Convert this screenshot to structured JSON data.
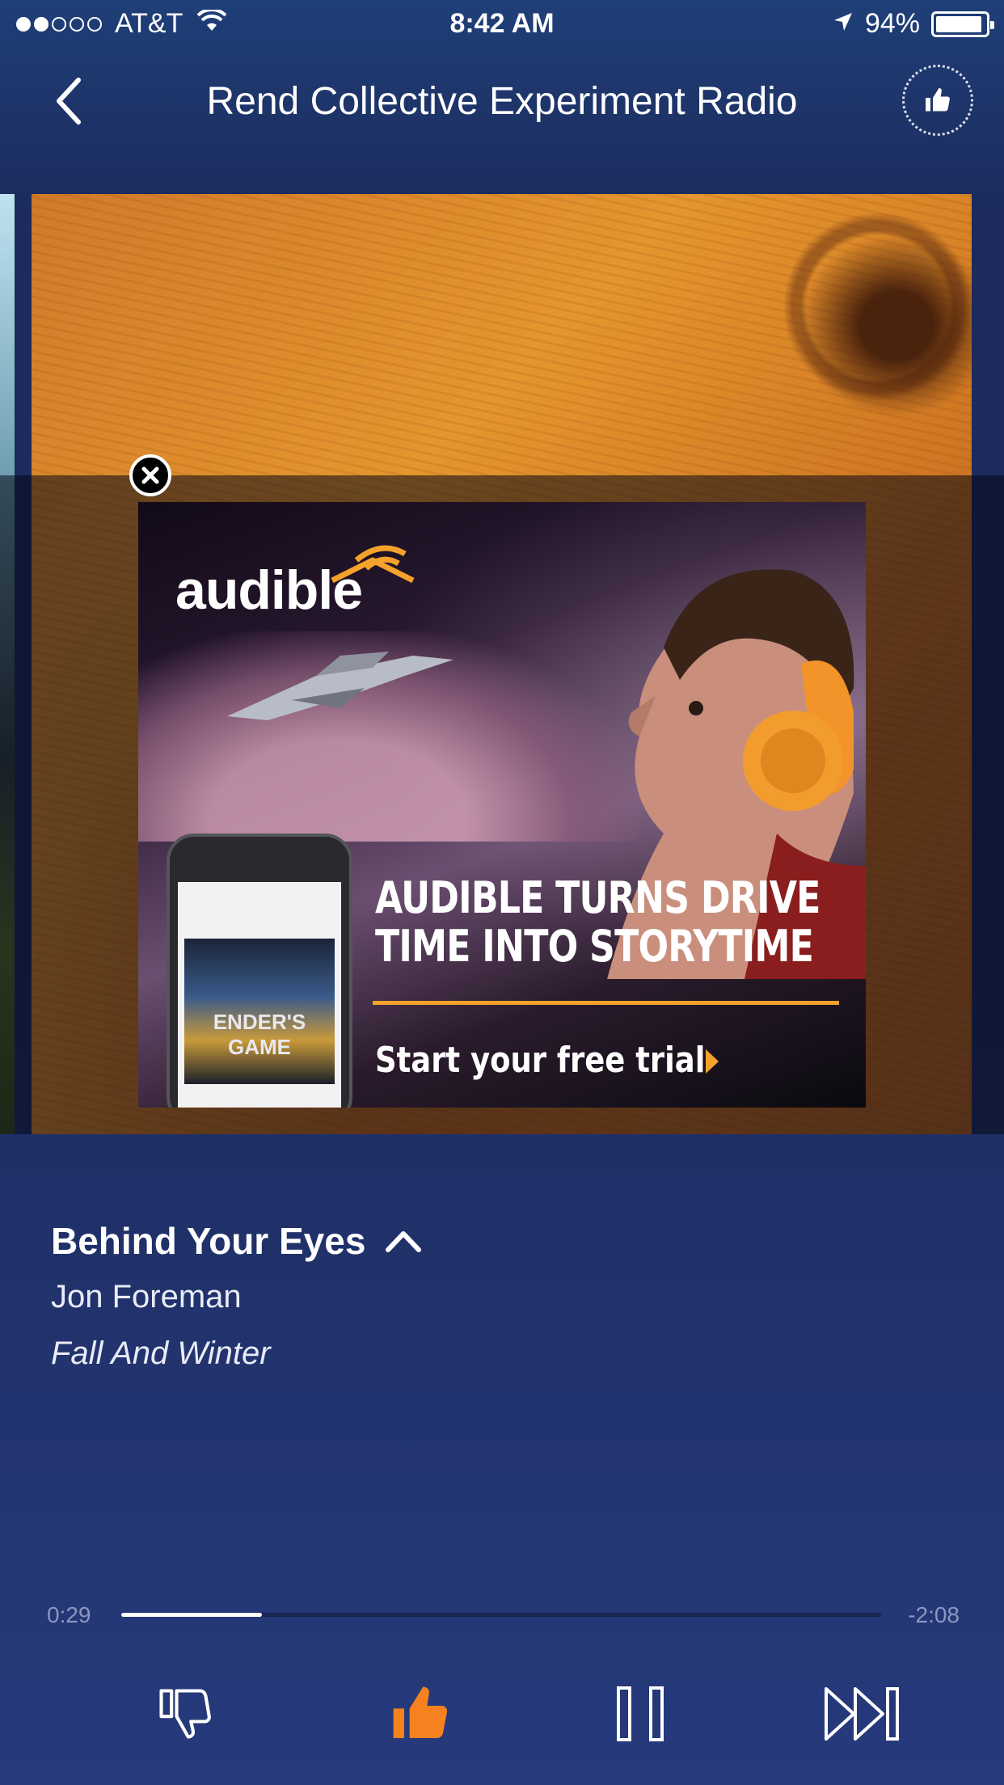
{
  "status_bar": {
    "carrier": "AT&T",
    "time": "8:42 AM",
    "battery": "94%",
    "battery_level": 0.94,
    "signal_bars_filled": 2,
    "signal_bars_total": 5
  },
  "header": {
    "title": "Rend Collective Experiment Radio",
    "back_icon": "chevron-left-icon",
    "badge_icon": "thumbs-up-icon"
  },
  "ad": {
    "brand": "audible",
    "headline_line1": "AUDIBLE TURNS DRIVE",
    "headline_line2": "TIME INTO STORYTIME",
    "cta": "Start your free trial",
    "phone_cover_title": "ENDER'S GAME",
    "accent_color": "#f4a22b"
  },
  "song": {
    "title": "Behind Your Eyes",
    "artist": "Jon Foreman",
    "album": "Fall And Winter"
  },
  "progress": {
    "elapsed": "0:29",
    "remaining": "-2:08",
    "fraction": 0.185
  },
  "controls": {
    "thumbs_down_icon": "thumbs-down-icon",
    "thumbs_up_icon": "thumbs-up-icon",
    "pause_icon": "pause-icon",
    "skip_icon": "skip-forward-icon",
    "thumbs_up_color": "#f5821f"
  }
}
